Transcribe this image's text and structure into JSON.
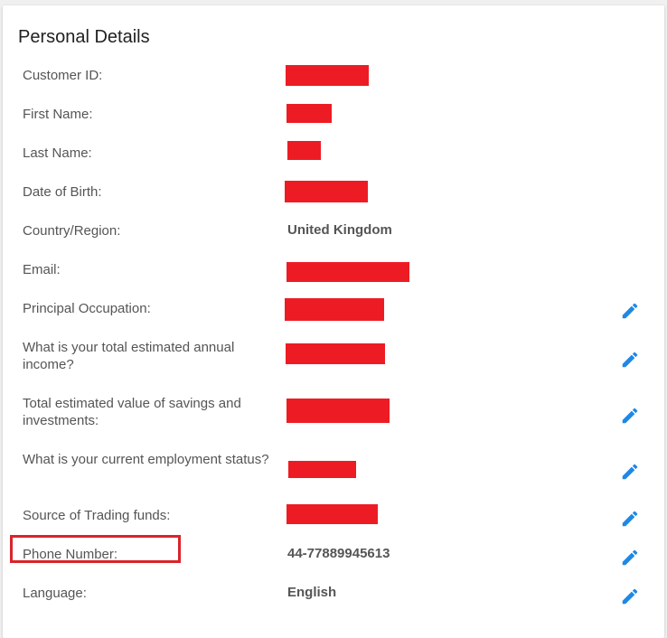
{
  "section": {
    "title": "Personal Details"
  },
  "rows": [
    {
      "label": "Customer ID:",
      "value": null
    },
    {
      "label": "First Name:",
      "value": null
    },
    {
      "label": "Last Name:",
      "value": null
    },
    {
      "label": "Date of Birth:",
      "value": null
    },
    {
      "label": "Country/Region:",
      "value": "United Kingdom"
    },
    {
      "label": "Email:",
      "value": null
    },
    {
      "label": "Principal Occupation:",
      "value": null,
      "editable": true
    },
    {
      "label": "What is your total estimated annual income?",
      "value": null,
      "editable": true
    },
    {
      "label": "Total estimated value of savings and investments:",
      "value": null,
      "editable": true
    },
    {
      "label": "What is your current employment status?",
      "value": null,
      "editable": true
    },
    {
      "label": "Source of Trading funds:",
      "value": null,
      "editable": true
    },
    {
      "label": "Phone Number:",
      "value": "44-77889945613",
      "editable": true,
      "highlighted": true
    },
    {
      "label": "Language:",
      "value": "English",
      "editable": true
    }
  ],
  "colors": {
    "edit_icon": "#1e88e5",
    "redaction": "#ed1c24",
    "highlight": "#d9242b"
  },
  "icons": {
    "edit": "pencil-icon"
  }
}
